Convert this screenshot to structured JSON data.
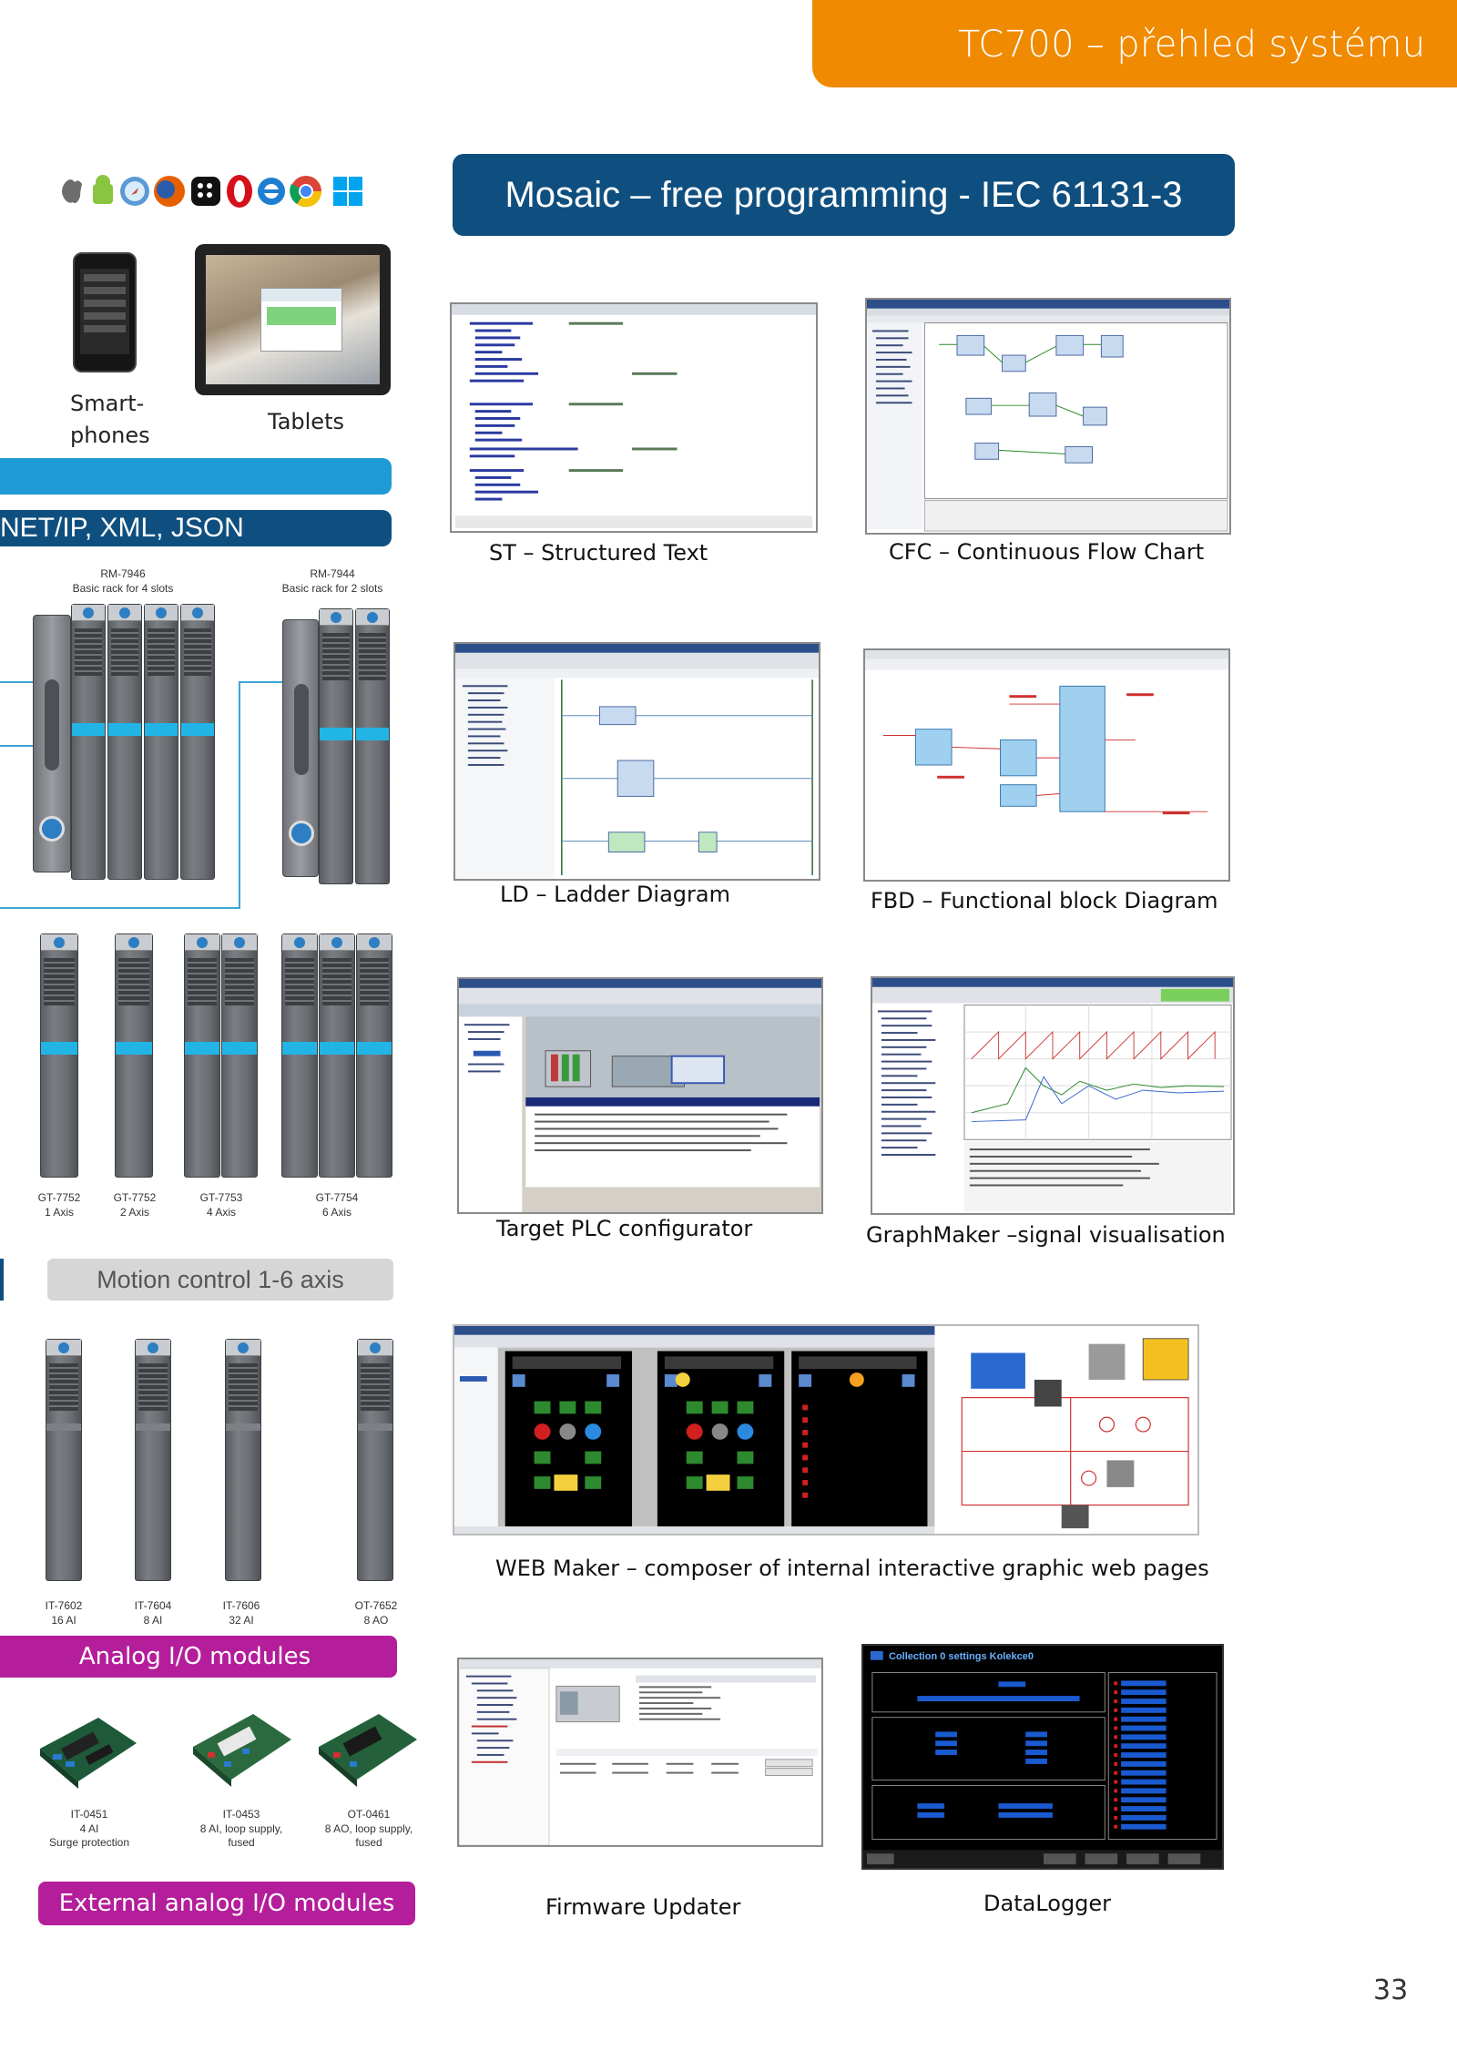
{
  "header": {
    "title": "TC700 – přehled systému"
  },
  "banner": {
    "title": "Mosaic – free programming - IEC 61131-3"
  },
  "left": {
    "browser_icons": [
      "apple-icon",
      "android-icon",
      "safari-icon",
      "firefox-icon",
      "blackberry-icon",
      "opera-icon",
      "ie-icon",
      "chrome-icon",
      "windows-icon"
    ],
    "smartphones_label_line1": "Smart-",
    "smartphones_label_line2": "phones",
    "tablets_label": "Tablets",
    "protocols_bar": "NET/IP, XML, JSON",
    "racks": [
      {
        "model": "RM-7946",
        "desc": "Basic rack for 4 slots"
      },
      {
        "model": "RM-7944",
        "desc": "Basic rack for 2 slots"
      }
    ],
    "motion_modules": [
      {
        "model": "GT-7752",
        "desc": "1 Axis"
      },
      {
        "model": "GT-7752",
        "desc": "2 Axis"
      },
      {
        "model": "GT-7753",
        "desc": "4 Axis"
      },
      {
        "model": "GT-7754",
        "desc": "6 Axis"
      }
    ],
    "motion_bar": "Motion control 1-6 axis",
    "analog_modules": [
      {
        "model": "IT-7602",
        "desc": "16 AI"
      },
      {
        "model": "IT-7604",
        "desc": "8 AI"
      },
      {
        "model": "IT-7606",
        "desc": "32 AI"
      },
      {
        "model": "OT-7652",
        "desc": "8 AO"
      }
    ],
    "analog_bar": "Analog I/O modules",
    "external_modules": [
      {
        "model": "IT-0451",
        "desc1": "4 AI",
        "desc2": "Surge protection"
      },
      {
        "model": "IT-0453",
        "desc1": "8 AI, loop supply,",
        "desc2": "fused"
      },
      {
        "model": "OT-0461",
        "desc1": "8 AO, loop supply,",
        "desc2": "fused"
      }
    ],
    "external_bar": "External analog I/O modules"
  },
  "captions": {
    "st": "ST – Structured Text",
    "cfc": "CFC – Continuous Flow Chart",
    "ld": "LD – Ladder Diagram",
    "fbd": "FBD – Functional block Diagram",
    "target": "Target PLC configurator",
    "graph": "GraphMaker –signal visualisation",
    "web": "WEB Maker – composer of internal interactive graphic web pages",
    "firmware": "Firmware Updater",
    "datalogger": "DataLogger"
  },
  "datalogger_title": "Collection 0 settings  Kolekce0",
  "page_number": "33",
  "colors": {
    "orange": "#f08a00",
    "navy": "#0f4f7f",
    "cyan": "#1e9ad6",
    "magenta": "#b41e9a",
    "grey_bar": "#d6d6d6"
  }
}
